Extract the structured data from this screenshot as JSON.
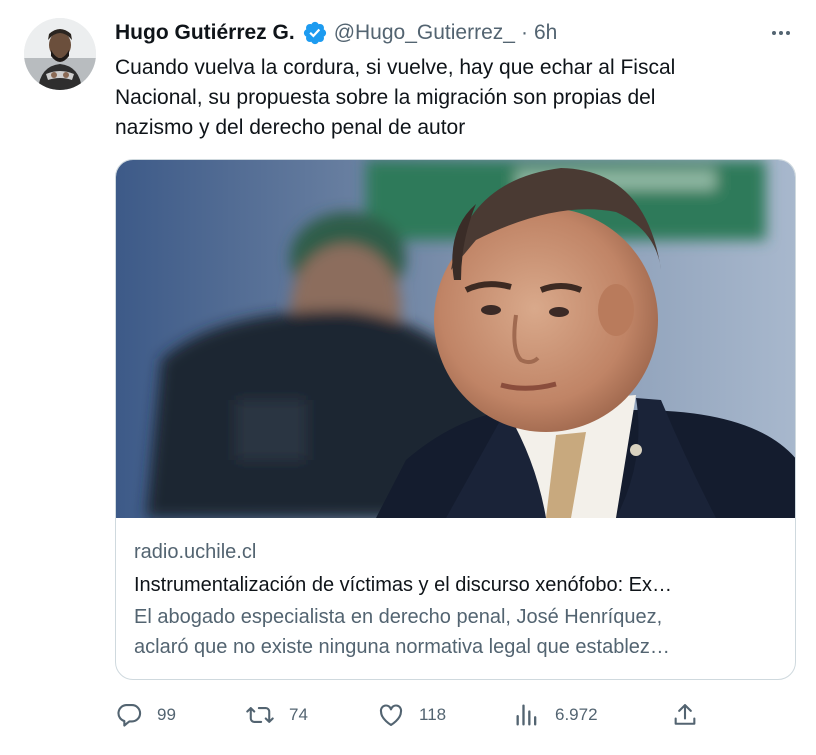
{
  "tweet": {
    "author": {
      "display_name": "Hugo Gutiérrez G.",
      "handle": "@Hugo_Gutierrez_",
      "verified": true,
      "verified_color": "#1d9bf0"
    },
    "separator": "·",
    "time": "6h",
    "text_lines": [
      "Cuando vuelva la cordura, si vuelve, hay que echar al Fiscal",
      "Nacional, su propuesta sobre la migración son propias del",
      "nazismo y del derecho penal de autor"
    ],
    "card": {
      "domain": "radio.uchile.cl",
      "title": "Instrumentalización de víctimas y el discurso xenófobo: Ex…",
      "description_lines": [
        "El abogado especialista en derecho penal, José Henríquez,",
        "aclaró que no existe ninguna normativa legal que establez…"
      ]
    },
    "actions": {
      "replies": "99",
      "retweets": "74",
      "likes": "118",
      "views": "6.972"
    }
  },
  "icons": {
    "verified": "verified-badge-icon",
    "more": "more-dots-icon",
    "reply": "reply-bubble-icon",
    "retweet": "retweet-icon",
    "like": "heart-icon",
    "views": "views-bar-chart-icon",
    "share": "share-upload-icon"
  },
  "colors": {
    "text": "#0f1419",
    "secondary": "#536471",
    "border": "#cfd9de",
    "accent": "#1d9bf0"
  }
}
